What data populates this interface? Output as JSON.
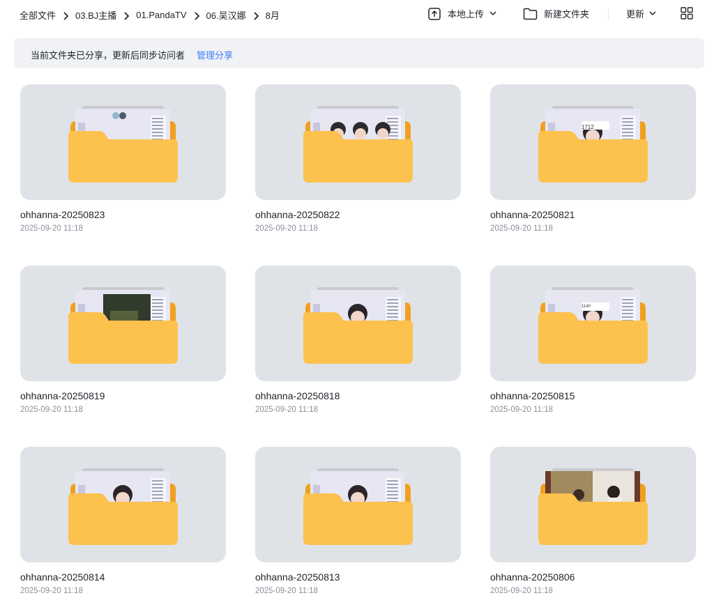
{
  "breadcrumbs": [
    "全部文件",
    "03.BJ主播",
    "01.PandaTV",
    "06.吴汉娜",
    "8月"
  ],
  "toolbar": {
    "upload_label": "本地上传",
    "new_folder_label": "新建文件夹",
    "sort_label": "更新"
  },
  "banner": {
    "text": "当前文件夹已分享，更新后同步访问者",
    "link": "管理分享"
  },
  "folders": [
    {
      "name": "ohhanna-20250823",
      "date": "2025-09-20 11:18",
      "preview": "stream-light"
    },
    {
      "name": "ohhanna-20250822",
      "date": "2025-09-20 11:18",
      "preview": "stream-triple"
    },
    {
      "name": "ohhanna-20250821",
      "date": "2025-09-20 11:18",
      "preview": "stream-badge",
      "badge": "1712"
    },
    {
      "name": "ohhanna-20250819",
      "date": "2025-09-20 11:18",
      "preview": "stream-dark"
    },
    {
      "name": "ohhanna-20250818",
      "date": "2025-09-20 11:18",
      "preview": "stream-cat"
    },
    {
      "name": "ohhanna-20250815",
      "date": "2025-09-20 11:18",
      "preview": "stream-badge",
      "badge": "1140"
    },
    {
      "name": "ohhanna-20250814",
      "date": "2025-09-20 11:18",
      "preview": "stream-person"
    },
    {
      "name": "ohhanna-20250813",
      "date": "2025-09-20 11:18",
      "preview": "stream-person"
    },
    {
      "name": "ohhanna-20250806",
      "date": "2025-09-20 11:18",
      "preview": "photo-outdoor"
    }
  ],
  "colors": {
    "folder_front": "#fdc14e",
    "folder_back": "#f0a020",
    "card_bg": "#dfe3e8",
    "banner_bg": "#f0f2f5",
    "link": "#3d7bf7"
  },
  "icons": [
    "chevron-right-icon",
    "upload-icon",
    "chevron-down-icon",
    "folder-outline-icon",
    "grid-view-icon"
  ]
}
